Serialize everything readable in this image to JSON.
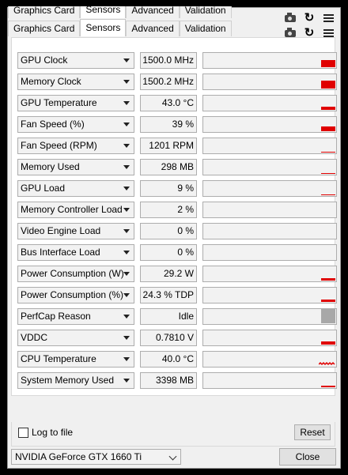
{
  "tabs": [
    {
      "label": "Graphics Card"
    },
    {
      "label": "Sensors"
    },
    {
      "label": "Advanced"
    },
    {
      "label": "Validation"
    }
  ],
  "active_tab": "Sensors",
  "accent_color": "#e00000",
  "sensors": [
    {
      "name": "GPU Clock",
      "value": "1500.0 MHz",
      "graph": {
        "type": "bar",
        "level": 0.45
      }
    },
    {
      "name": "Memory Clock",
      "value": "1500.2 MHz",
      "graph": {
        "type": "bar",
        "level": 0.5
      }
    },
    {
      "name": "GPU Temperature",
      "value": "43.0 °C",
      "graph": {
        "type": "bar",
        "level": 0.2
      }
    },
    {
      "name": "Fan Speed (%)",
      "value": "39 %",
      "graph": {
        "type": "bar",
        "level": 0.3
      }
    },
    {
      "name": "Fan Speed (RPM)",
      "value": "1201 RPM",
      "graph": {
        "type": "bar",
        "level": 0.06
      }
    },
    {
      "name": "Memory Used",
      "value": "298 MB",
      "graph": {
        "type": "bar",
        "level": 0.05
      }
    },
    {
      "name": "GPU Load",
      "value": "9 %",
      "graph": {
        "type": "bar",
        "level": 0.05
      }
    },
    {
      "name": "Memory Controller Load",
      "value": "2 %",
      "graph": {
        "type": "none",
        "level": 0
      }
    },
    {
      "name": "Video Engine Load",
      "value": "0 %",
      "graph": {
        "type": "none",
        "level": 0
      }
    },
    {
      "name": "Bus Interface Load",
      "value": "0 %",
      "graph": {
        "type": "none",
        "level": 0
      }
    },
    {
      "name": "Power Consumption (W)",
      "value": "29.2 W",
      "graph": {
        "type": "bar",
        "level": 0.15
      }
    },
    {
      "name": "Power Consumption (%)",
      "value": "24.3 % TDP",
      "graph": {
        "type": "bar",
        "level": 0.15
      }
    },
    {
      "name": "PerfCap Reason",
      "value": "Idle",
      "graph": {
        "type": "gray",
        "level": 0.95
      }
    },
    {
      "name": "VDDC",
      "value": "0.7810 V",
      "graph": {
        "type": "bar",
        "level": 0.2
      }
    },
    {
      "name": "CPU Temperature",
      "value": "40.0 °C",
      "graph": {
        "type": "spark",
        "level": 0.15
      }
    },
    {
      "name": "System Memory Used",
      "value": "3398 MB",
      "graph": {
        "type": "bar",
        "level": 0.1
      }
    }
  ],
  "log_to_file_label": "Log to file",
  "log_to_file_checked": false,
  "reset_label": "Reset",
  "device_name": "NVIDIA GeForce GTX 1660 Ti",
  "close_label": "Close",
  "icons": {
    "screenshot": "camera-icon",
    "refresh": "refresh-icon",
    "menu": "menu-icon"
  }
}
